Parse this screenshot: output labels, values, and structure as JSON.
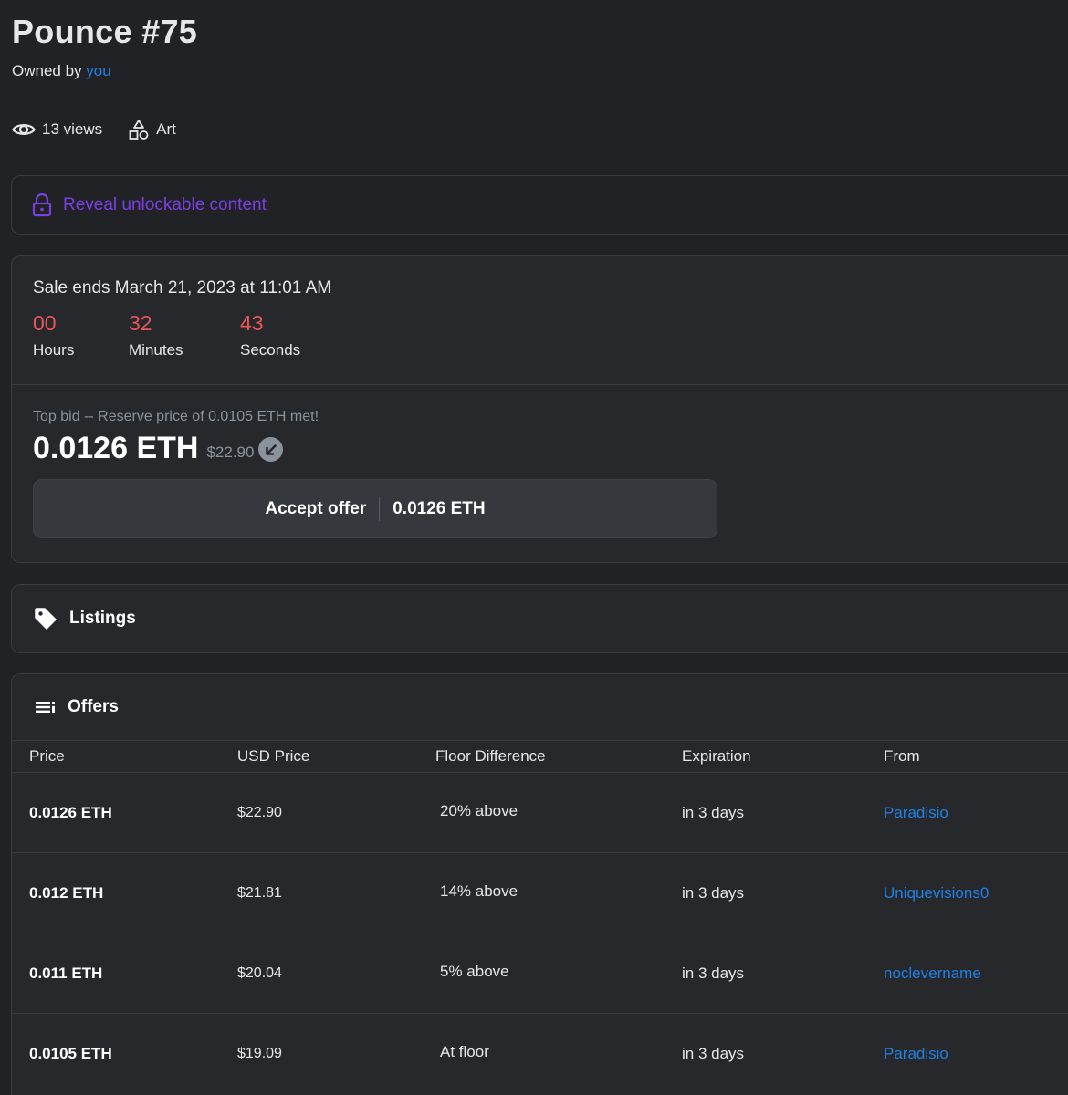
{
  "header": {
    "title": "Pounce #75",
    "owned_prefix": "Owned by",
    "owner": "you",
    "views": "13 views",
    "category": "Art"
  },
  "unlockable": {
    "label": "Reveal unlockable content"
  },
  "sale": {
    "ends_text": "Sale ends March 21, 2023 at 11:01 AM",
    "timer": [
      {
        "value": "00",
        "label": "Hours"
      },
      {
        "value": "32",
        "label": "Minutes"
      },
      {
        "value": "43",
        "label": "Seconds"
      }
    ],
    "top_bid_text": "Top bid -- Reserve price of 0.0105 ETH met!",
    "price_eth": "0.0126 ETH",
    "price_usd": "$22.90",
    "accept_label": "Accept offer",
    "accept_price": "0.0126 ETH"
  },
  "listings": {
    "title": "Listings"
  },
  "offers": {
    "title": "Offers",
    "columns": [
      "Price",
      "USD Price",
      "Floor Difference",
      "Expiration",
      "From"
    ],
    "rows": [
      {
        "price": "0.0126 ETH",
        "usd": "$22.90",
        "floor": "20% above",
        "expiration": "in 3 days",
        "from": "Paradisio"
      },
      {
        "price": "0.012 ETH",
        "usd": "$21.81",
        "floor": "14% above",
        "expiration": "in 3 days",
        "from": "Uniquevisions0"
      },
      {
        "price": "0.011 ETH",
        "usd": "$20.04",
        "floor": "5% above",
        "expiration": "in 3 days",
        "from": "noclevername"
      },
      {
        "price": "0.0105 ETH",
        "usd": "$19.09",
        "floor": "At floor",
        "expiration": "in 3 days",
        "from": "Paradisio"
      }
    ]
  },
  "colors": {
    "background": "#202225",
    "panel": "#26282c",
    "link": "#2081e2",
    "unlock": "#7b3fe4",
    "timer": "#eb5757"
  },
  "icons": {
    "views": "eye-icon",
    "category": "shapes-icon",
    "unlock": "lock-icon",
    "price_change": "arrow-down-left-icon",
    "listings": "tag-icon",
    "offers": "list-icon"
  }
}
